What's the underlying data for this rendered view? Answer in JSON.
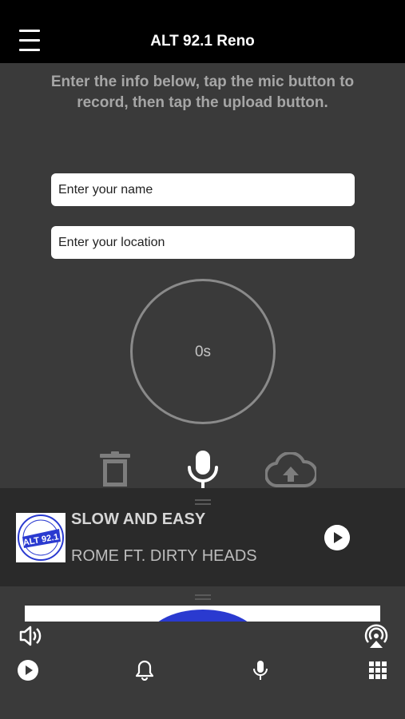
{
  "header": {
    "title": "ALT 92.1 Reno",
    "menu_icon": "hamburger-menu-icon"
  },
  "instructions": "Enter the info below, tap the mic button to record, then tap the upload button.",
  "form": {
    "name_placeholder": "Enter your name",
    "location_placeholder": "Enter your location"
  },
  "recorder": {
    "timer": "0s",
    "actions": [
      "trash-icon",
      "microphone-icon",
      "cloud-upload-icon"
    ]
  },
  "now_playing": {
    "title": "SLOW AND EASY",
    "artist": "ROME FT. DIRTY HEADS",
    "album_art_text": "RENO'S ALT 92.1 ALTERNATIVE"
  },
  "bottom_bar": {
    "icons": [
      "volume-icon",
      "airplay-icon",
      "play-icon",
      "bell-icon",
      "microphone-icon",
      "grid-icon"
    ]
  },
  "colors": {
    "background": "#3a3a3a",
    "header": "#000000",
    "now_playing_bg": "#2a2a2a",
    "logo_blue": "#2a3ad0"
  }
}
